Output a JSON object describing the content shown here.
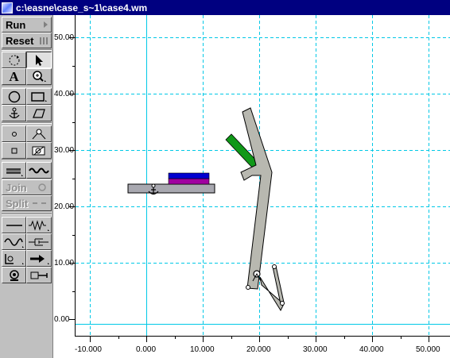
{
  "window": {
    "title": "c:\\easne\\case_s~1\\case4.wm"
  },
  "toolbar": {
    "run_label": "Run",
    "reset_label": "Reset",
    "text_tool_label": "A",
    "join_label": "Join",
    "split_label": "Split",
    "tools": [
      "rotate-tool-icon",
      "pointer-icon",
      "text-icon",
      "zoom-icon",
      "circle-icon",
      "rectangle-icon",
      "anchor-icon",
      "polygon-icon",
      "point-icon",
      "pin-joint-icon",
      "square-point-icon",
      "slot-joint-icon",
      "rigid-joint-icon",
      "rope-icon",
      "rod-icon",
      "spring-icon",
      "spring-damper-icon",
      "damper-icon",
      "rotary-motor-icon",
      "force-icon",
      "motor-icon",
      "actuator-icon"
    ]
  },
  "axes": {
    "y_ticks": [
      "50.00",
      "40.00",
      "30.00",
      "20.00",
      "10.00",
      "0.00"
    ],
    "x_ticks": [
      "-10.000",
      "0.000",
      "10.000",
      "20.000",
      "30.000",
      "40.000",
      "50.000"
    ],
    "grid": true,
    "grid_color": "#00c8e6"
  },
  "colors": {
    "titlebar": "#000080",
    "body_gray": "#c0c0c0",
    "green_bar": "#109818",
    "blue_block": "#0000d0",
    "purple_block": "#a000a0"
  }
}
